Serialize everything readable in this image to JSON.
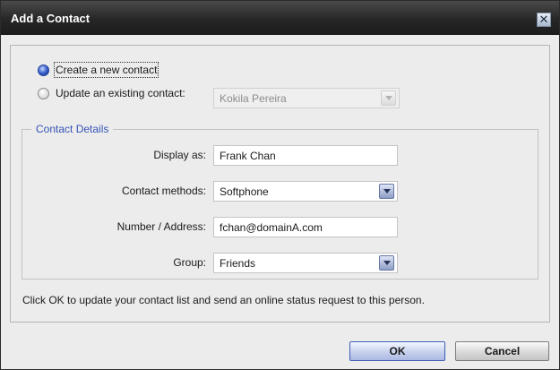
{
  "window": {
    "title": "Add a Contact",
    "close_glyph": "✕"
  },
  "mode": {
    "create_label": "Create a new contact",
    "update_label": "Update an existing contact:",
    "selected": "create",
    "existing_contact_value": "Kokila Pereira"
  },
  "details": {
    "legend": "Contact Details",
    "display_as_label": "Display as:",
    "display_as_value": "Frank Chan",
    "methods_label": "Contact methods:",
    "methods_value": "Softphone",
    "address_label": "Number / Address:",
    "address_value": "fchan@domainA.com",
    "group_label": "Group:",
    "group_value": "Friends"
  },
  "note": "Click OK to update your contact list and send an online status request to this person.",
  "buttons": {
    "ok": "OK",
    "cancel": "Cancel"
  },
  "colors": {
    "accent": "#3554b7",
    "titlebar": "#262626"
  },
  "icons": {
    "close": "close-icon",
    "dropdown": "chevron-down-icon",
    "radio": "radio-button"
  }
}
